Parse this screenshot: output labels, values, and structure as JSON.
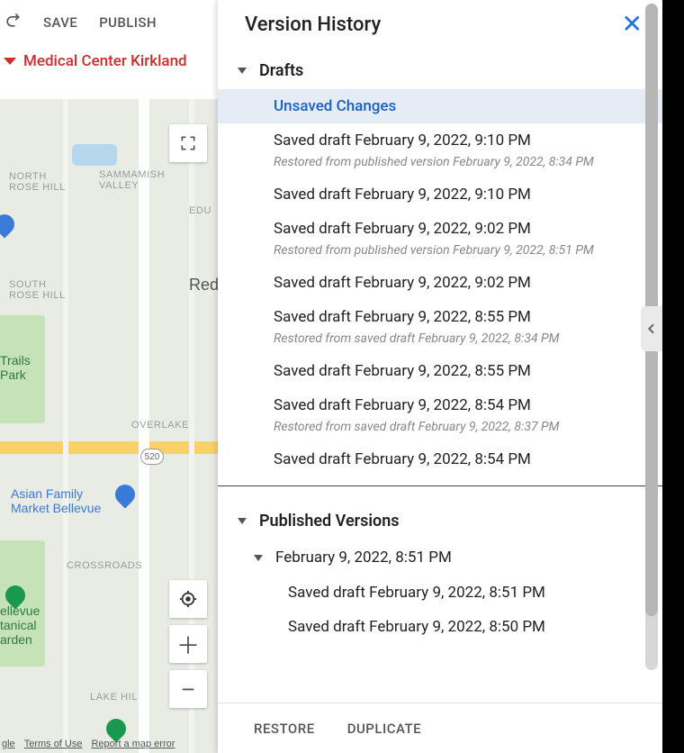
{
  "toolbar": {
    "save_label": "SAVE",
    "publish_label": "PUBLISH"
  },
  "breadcrumb": {
    "title": "Medical Center Kirkland"
  },
  "map": {
    "neighborhoods": {
      "n0": "NORTH\nROSE HILL",
      "n1": "SAMMAMISH\nVALLEY",
      "n2": "SOUTH\nROSE HILL",
      "n3": "OVERLAKE",
      "n4": "CROSSROADS",
      "n5": "LAKE HIL",
      "n6": "EDU"
    },
    "cutoff_right": "Redm",
    "hwy_shield": "520",
    "poi_trails": "Trails\nPark",
    "poi_market": "Asian Family\nMarket Bellevue",
    "poi_garden": "ellevue\ntanical\narden",
    "attribution": {
      "a0": "gle",
      "a1": "Terms of Use",
      "a2": "Report a map error"
    }
  },
  "panel": {
    "title": "Version History",
    "sections": {
      "drafts_title": "Drafts",
      "published_title": "Published Versions"
    },
    "drafts": [
      {
        "label": "Unsaved Changes",
        "note": null,
        "selected": true
      },
      {
        "label": "Saved draft February 9, 2022, 9:10 PM",
        "note": "Restored from published version February 9, 2022, 8:34 PM"
      },
      {
        "label": "Saved draft February 9, 2022, 9:10 PM",
        "note": null
      },
      {
        "label": "Saved draft February 9, 2022, 9:02 PM",
        "note": "Restored from published version February 9, 2022, 8:51 PM"
      },
      {
        "label": "Saved draft February 9, 2022, 9:02 PM",
        "note": null
      },
      {
        "label": "Saved draft February 9, 2022, 8:55 PM",
        "note": "Restored from saved draft February 9, 2022, 8:34 PM"
      },
      {
        "label": "Saved draft February 9, 2022, 8:55 PM",
        "note": null
      },
      {
        "label": "Saved draft February 9, 2022, 8:54 PM",
        "note": "Restored from saved draft February 9, 2022, 8:37 PM"
      },
      {
        "label": "Saved draft February 9, 2022, 8:54 PM",
        "note": null
      }
    ],
    "published_version": {
      "date": "February 9, 2022, 8:51 PM",
      "children": [
        "Saved draft February 9, 2022, 8:51 PM",
        "Saved draft February 9, 2022, 8:50 PM"
      ]
    },
    "footer": {
      "restore_label": "RESTORE",
      "duplicate_label": "DUPLICATE"
    }
  }
}
